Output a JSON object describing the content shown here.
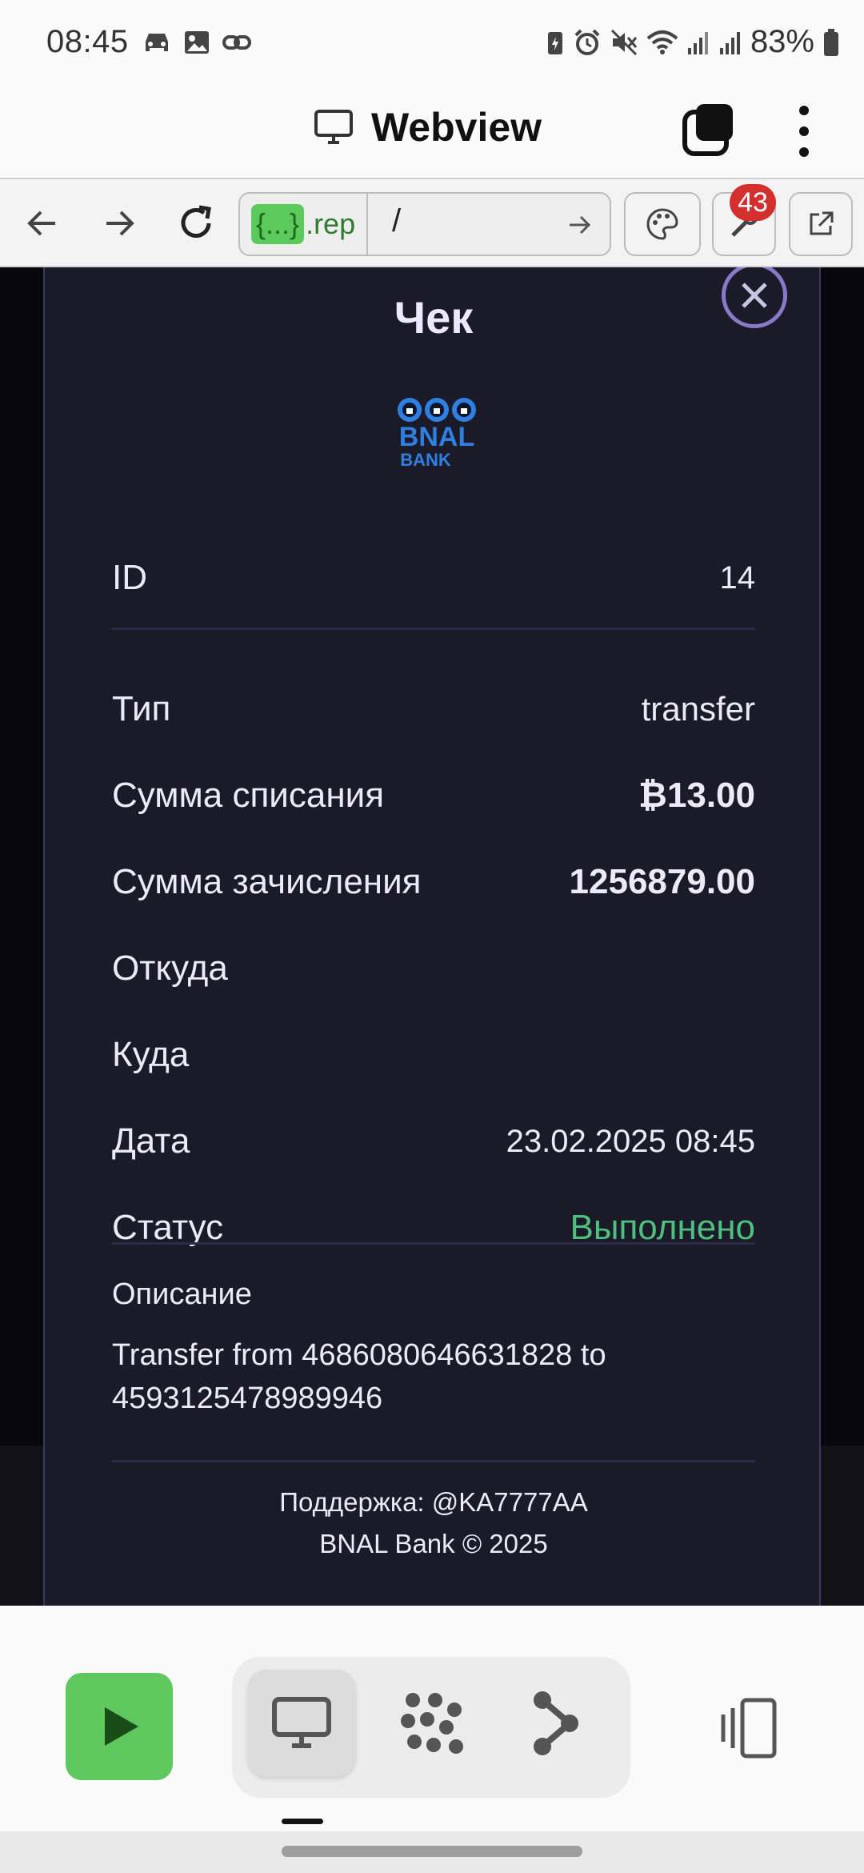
{
  "status_bar": {
    "time": "08:45",
    "battery_percent": "83%",
    "left_icons": [
      "car-icon",
      "image-icon",
      "link-icon"
    ],
    "right_icons": [
      "battery-saver-icon",
      "alarm-icon",
      "mute-icon",
      "wifi-icon",
      "signal-icon",
      "signal-icon",
      "battery-icon"
    ]
  },
  "app_bar": {
    "title": "Webview"
  },
  "browser_bar": {
    "url_badge": "{...}",
    "url_host": ".rep",
    "url_path": "/",
    "notification_count": "43"
  },
  "receipt": {
    "title": "Чек",
    "id_label": "ID",
    "id_value": "14",
    "type_label": "Тип",
    "type_value": "transfer",
    "debit_label": "Сумма списания",
    "debit_value": "₿13.00",
    "credit_label": "Сумма зачисления",
    "credit_value": "1256879.00",
    "from_label": "Откуда",
    "to_label": "Куда",
    "date_label": "Дата",
    "date_value": "23.02.2025 08:45",
    "status_label": "Статус",
    "status_value": "Выполнено",
    "description_label": "Описание",
    "description_line1": "Transfer from 4686080646631828 to",
    "description_line2": "4593125478989946",
    "support": "Поддержка: @KA7777AA",
    "copyright": "BNAL Bank © 2025"
  },
  "colors": {
    "accent_green": "#5ec75e",
    "status_ok": "#4fbf80",
    "modal_bg": "#1b1a28",
    "close_ring": "#8a78c8",
    "badge_red": "#d32f2f",
    "logo_blue": "#2f7fe0"
  },
  "bottom_bar": {
    "icons": [
      "play-icon",
      "desktop-icon",
      "grid-dots-icon",
      "graph-node-icon",
      "rotate-screen-icon"
    ]
  }
}
